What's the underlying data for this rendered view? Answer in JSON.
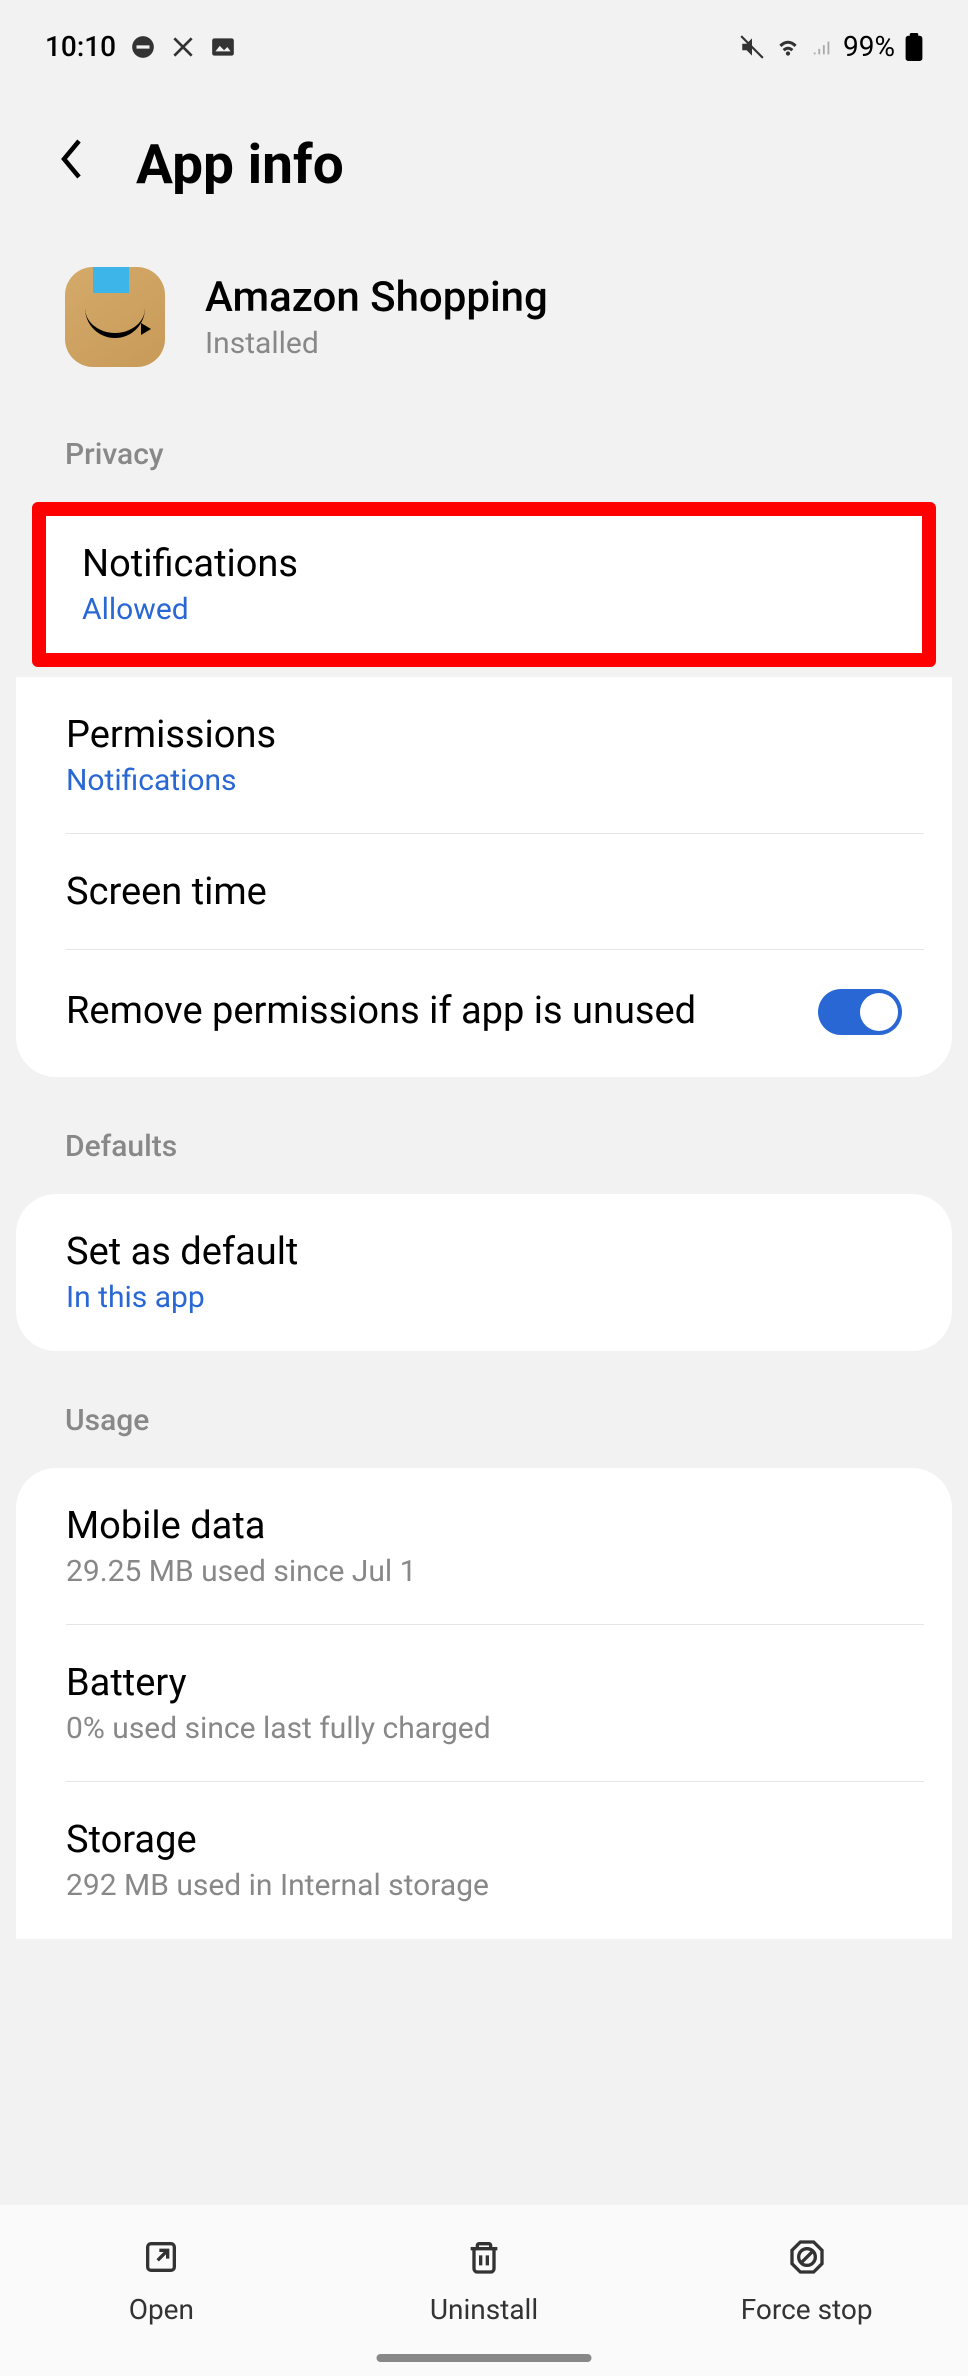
{
  "status_bar": {
    "time": "10:10",
    "battery": "99%"
  },
  "header": {
    "title": "App info"
  },
  "app": {
    "name": "Amazon Shopping",
    "status": "Installed"
  },
  "sections": {
    "privacy": {
      "label": "Privacy",
      "notifications": {
        "title": "Notifications",
        "subtitle": "Allowed"
      },
      "permissions": {
        "title": "Permissions",
        "subtitle": "Notifications"
      },
      "screen_time": {
        "title": "Screen time"
      },
      "remove_permissions": {
        "title": "Remove permissions if app is unused"
      }
    },
    "defaults": {
      "label": "Defaults",
      "set_default": {
        "title": "Set as default",
        "subtitle": "In this app"
      }
    },
    "usage": {
      "label": "Usage",
      "mobile_data": {
        "title": "Mobile data",
        "subtitle": "29.25 MB used since Jul 1"
      },
      "battery": {
        "title": "Battery",
        "subtitle": "0% used since last fully charged"
      },
      "storage": {
        "title": "Storage",
        "subtitle": "292 MB used in Internal storage"
      }
    }
  },
  "bottom_nav": {
    "open": "Open",
    "uninstall": "Uninstall",
    "force_stop": "Force stop"
  }
}
